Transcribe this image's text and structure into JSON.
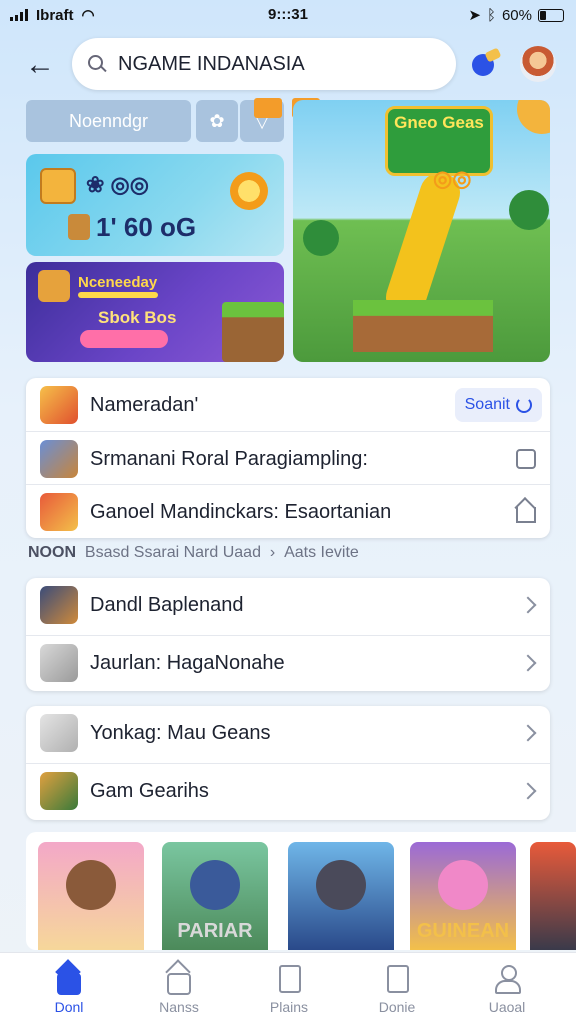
{
  "status_bar": {
    "carrier": "Ibraft",
    "time": "9:::31",
    "battery": "60%"
  },
  "search": {
    "value": "NGAME INDANASIA"
  },
  "banner": {
    "chip_label": "Noenndgr",
    "chip_icon": "puzzle-icon",
    "tile_a_row1": "❀ ◎◎",
    "tile_a_row2": "1' 60 oG",
    "tile_b_title": "Nceneeday",
    "tile_b_subtitle": "Sbok Bos",
    "hero_logo": "Gneo Geas"
  },
  "list1": [
    {
      "label": "Nameradan'",
      "action": "Soanit",
      "action_icon": "refresh-icon"
    },
    {
      "label": "Srmanani Roral Paragiampling:",
      "action_icon": "edit-icon"
    },
    {
      "label": "Ganoel Mandinckars: Esaortanian",
      "action_icon": "home-icon"
    }
  ],
  "breadcrumb": {
    "prefix": "NOON",
    "middle": "Bsasd Ssarai Nard Uaad",
    "sep": "›",
    "last": "Aats Ievite"
  },
  "list2": [
    {
      "label": "Dandl Baplenand"
    },
    {
      "label": "Jaurlan: HagaNonahe"
    }
  ],
  "list3": [
    {
      "label": "Yonkag: Mau Geans"
    },
    {
      "label": "Gam Gearihs"
    }
  ],
  "games": [
    {
      "caption": "",
      "bg": "#f3a8c8"
    },
    {
      "caption": "PARIAR",
      "bg": "#7ac6a0"
    },
    {
      "caption": "",
      "bg": "#6fb6e8"
    },
    {
      "caption": "GUINEAN",
      "bg": "#9b6ad6"
    }
  ],
  "tabs": [
    {
      "label": "Donl",
      "icon": "home-icon",
      "active": true
    },
    {
      "label": "Nanss",
      "icon": "games-icon"
    },
    {
      "label": "Plains",
      "icon": "document-icon"
    },
    {
      "label": "Donie",
      "icon": "list-icon"
    },
    {
      "label": "Uaoal",
      "icon": "profile-icon"
    }
  ],
  "colors": {
    "accent": "#2b52e6",
    "background": "#e7f1fb"
  }
}
